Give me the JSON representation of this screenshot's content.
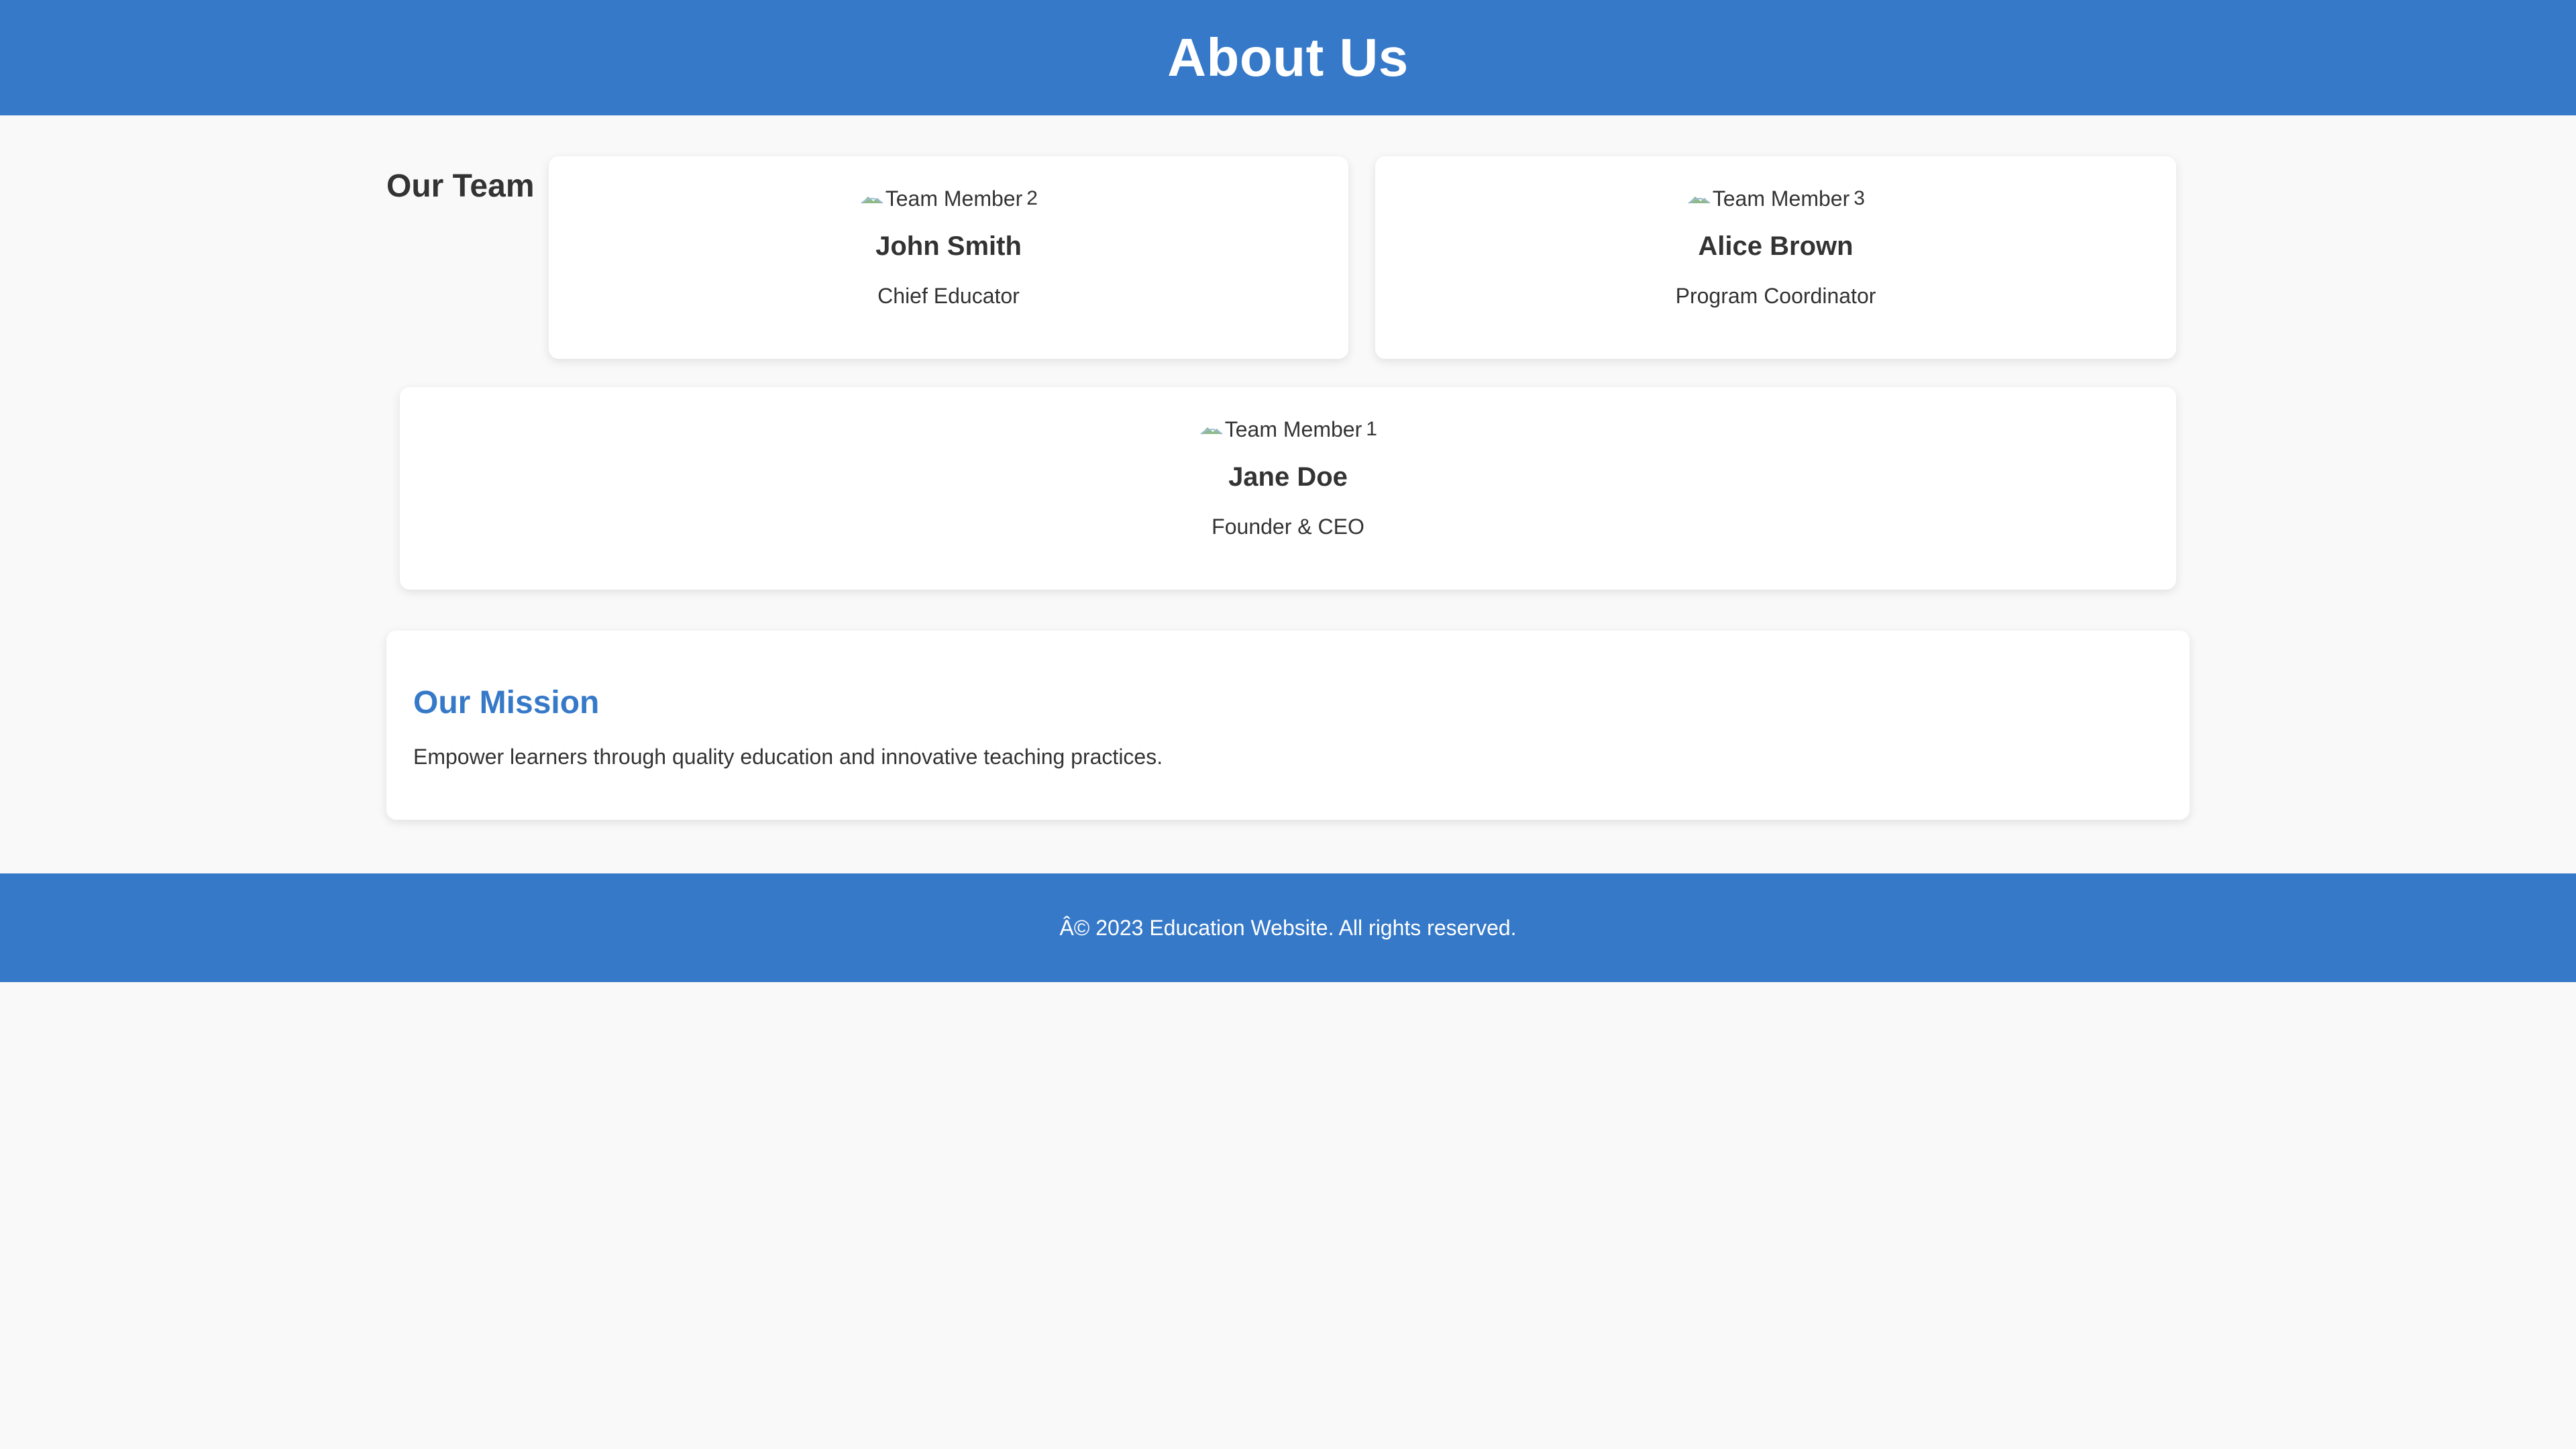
{
  "header": {
    "title": "About Us"
  },
  "team": {
    "heading": "Our Team",
    "members": [
      {
        "photo_alt": "Team Member",
        "photo_tail": "2",
        "name": "John Smith",
        "role": "Chief Educator"
      },
      {
        "photo_alt": "Team Member",
        "photo_tail": "3",
        "name": "Alice Brown",
        "role": "Program Coordinator"
      },
      {
        "photo_alt": "Team Member",
        "photo_tail": "1",
        "name": "Jane Doe",
        "role": "Founder & CEO"
      }
    ]
  },
  "mission": {
    "heading": "Our Mission",
    "text": "Empower learners through quality education and innovative teaching practices."
  },
  "footer": {
    "text": "Â© 2023 Education Website. All rights reserved."
  },
  "colors": {
    "brand_blue": "#3679c8",
    "page_background": "#f9f9f9",
    "card_background": "#ffffff",
    "text": "#333333"
  }
}
